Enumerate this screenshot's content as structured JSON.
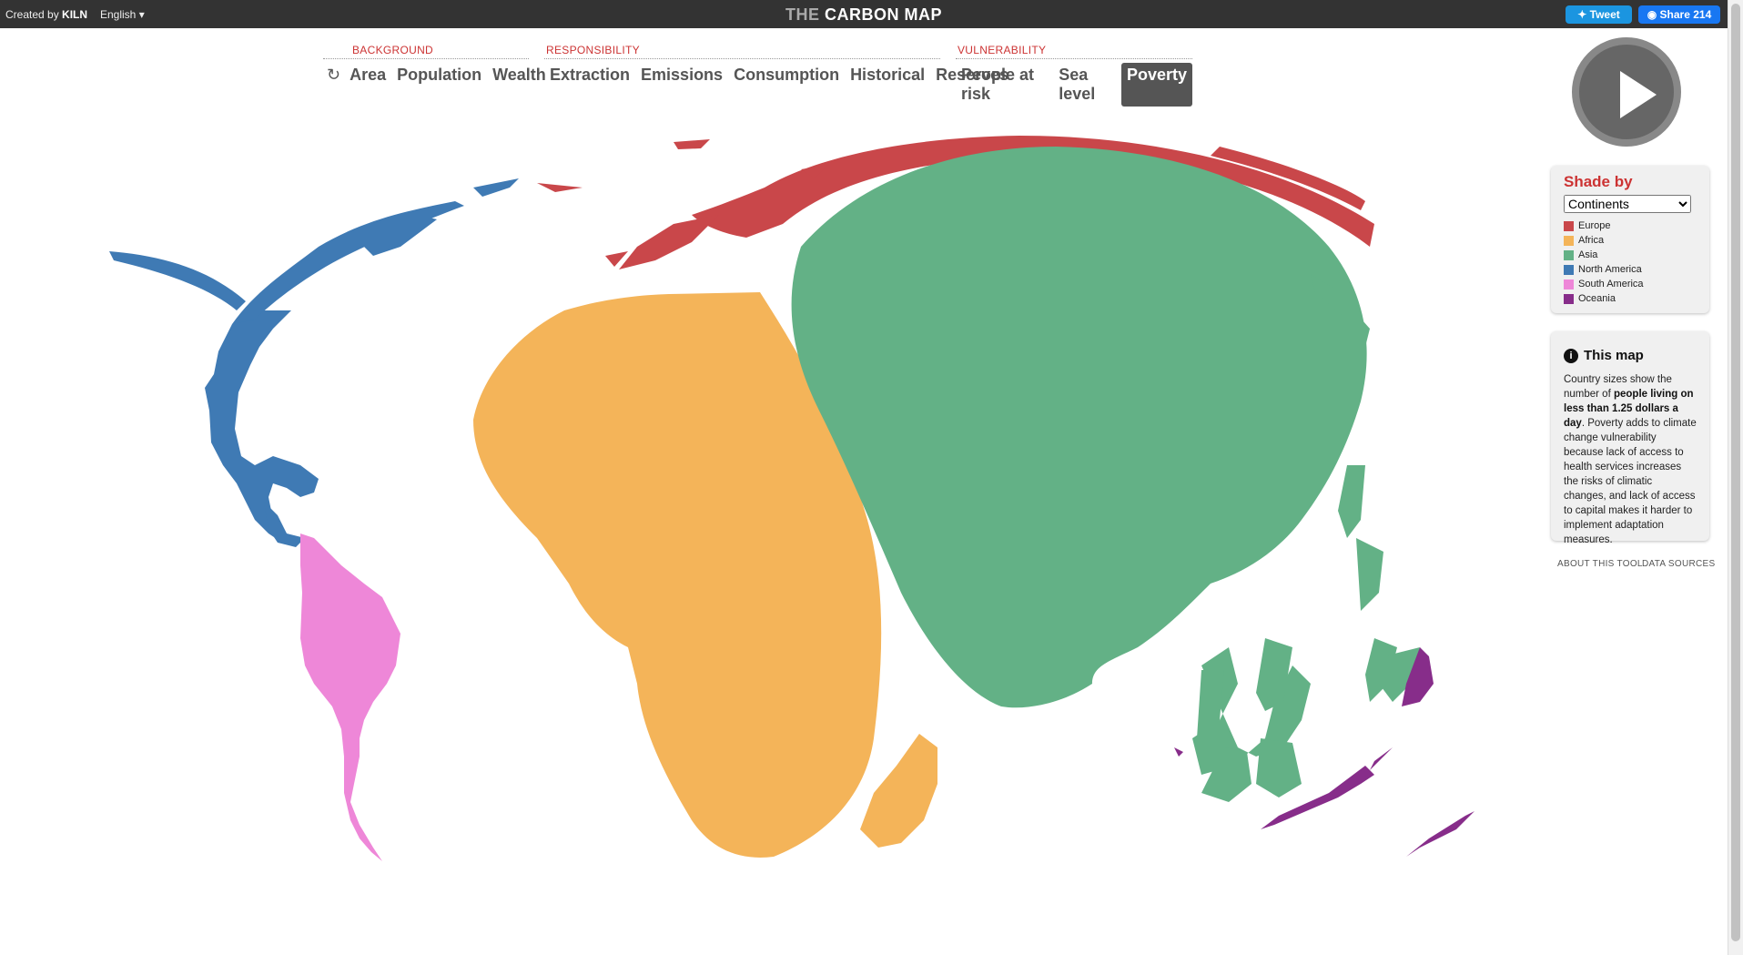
{
  "topbar": {
    "credit_prefix": "Created by ",
    "credit_brand": "KILN",
    "language": "English",
    "title_prefix": "THE",
    "title_main": "CARBON MAP",
    "tweet_label": "Tweet",
    "share_label": "Share 214"
  },
  "menu": {
    "background": {
      "label": "BACKGROUND",
      "items": [
        "Area",
        "Population",
        "Wealth"
      ]
    },
    "responsibility": {
      "label": "RESPONSIBILITY",
      "items": [
        "Extraction",
        "Emissions",
        "Consumption",
        "Historical",
        "Reserves"
      ]
    },
    "vulnerability": {
      "label": "VULNERABILITY",
      "items": [
        "People at risk",
        "Sea level",
        "Poverty"
      ]
    },
    "active": "Poverty"
  },
  "shade": {
    "title": "Shade by",
    "selected": "Continents",
    "legend": [
      {
        "label": "Europe",
        "color": "#c9474a"
      },
      {
        "label": "Africa",
        "color": "#f4b459"
      },
      {
        "label": "Asia",
        "color": "#63b186"
      },
      {
        "label": "North America",
        "color": "#3f7ab4"
      },
      {
        "label": "South America",
        "color": "#ee87d8"
      },
      {
        "label": "Oceania",
        "color": "#872d8a"
      }
    ]
  },
  "info": {
    "title": "This map",
    "text_1": "Country sizes show the number of ",
    "text_bold": "people living on less than 1.25 dollars a day",
    "text_2": ". Poverty adds to climate change vulnerability because lack of access to health services increases the risks of climatic changes, and lack of access to capital makes it harder to implement adaptation measures."
  },
  "links": {
    "about": "ABOUT THIS TOOL",
    "sources": "DATA SOURCES"
  }
}
